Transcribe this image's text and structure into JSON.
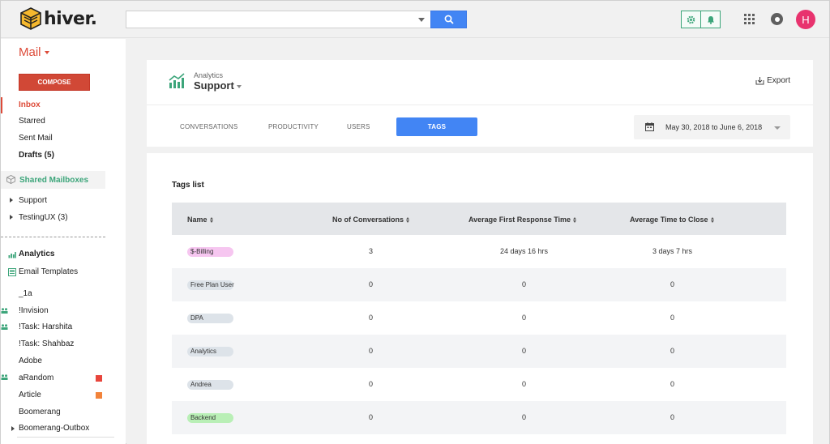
{
  "brand": {
    "name": "hiver."
  },
  "header": {
    "search_placeholder": "",
    "avatar_initial": "H"
  },
  "sidebar": {
    "mail_label": "Mail",
    "compose_label": "COMPOSE",
    "nav": [
      {
        "label": "Inbox"
      },
      {
        "label": "Starred"
      },
      {
        "label": "Sent Mail"
      },
      {
        "label": "Drafts (5)"
      }
    ],
    "shared_mailboxes_label": "Shared Mailboxes",
    "mailboxes": [
      {
        "label": "Support"
      },
      {
        "label": "TestingUX (3)"
      }
    ],
    "tools": [
      {
        "label": "Analytics"
      },
      {
        "label": "Email Templates"
      }
    ],
    "labels": [
      {
        "label": "_1a"
      },
      {
        "label": "!Invision"
      },
      {
        "label": "!Task: Harshita"
      },
      {
        "label": "!Task: Shahbaz"
      },
      {
        "label": "Adobe"
      },
      {
        "label": "aRandom",
        "color": "#e8453c"
      },
      {
        "label": "Article",
        "color": "#f2833a"
      },
      {
        "label": "Boomerang"
      },
      {
        "label": "Boomerang-Outbox"
      }
    ]
  },
  "page": {
    "section_small": "Analytics",
    "section_title": "Support",
    "export_label": "Export",
    "tabs": [
      {
        "label": "CONVERSATIONS"
      },
      {
        "label": "PRODUCTIVITY"
      },
      {
        "label": "USERS"
      },
      {
        "label": "TAGS"
      }
    ],
    "date_range": "May 30, 2018 to June 6, 2018"
  },
  "tags_table": {
    "title": "Tags list",
    "columns": [
      "Name",
      "No of Conversations",
      "Average First Response Time",
      "Average Time to Close"
    ],
    "rows": [
      {
        "tag": "$-Billing",
        "tag_color": "#f6c6f0",
        "conversations": "3",
        "first_response": "24 days 16 hrs",
        "time_to_close": "3 days 7 hrs"
      },
      {
        "tag": "Free Plan User",
        "tag_color": "#dde3e9",
        "conversations": "0",
        "first_response": "0",
        "time_to_close": "0"
      },
      {
        "tag": "DPA",
        "tag_color": "#dde3e9",
        "conversations": "0",
        "first_response": "0",
        "time_to_close": "0"
      },
      {
        "tag": "Analytics",
        "tag_color": "#dde3e9",
        "conversations": "0",
        "first_response": "0",
        "time_to_close": "0"
      },
      {
        "tag": "Andrea",
        "tag_color": "#dde3e9",
        "conversations": "0",
        "first_response": "0",
        "time_to_close": "0"
      },
      {
        "tag": "Backend",
        "tag_color": "#b9efb6",
        "conversations": "0",
        "first_response": "0",
        "time_to_close": "0"
      }
    ]
  },
  "colors": {
    "accent": "#4285f4",
    "mail_red": "#dd4b39",
    "hiver_green": "#3ca57a",
    "avatar": "#e8336e"
  }
}
